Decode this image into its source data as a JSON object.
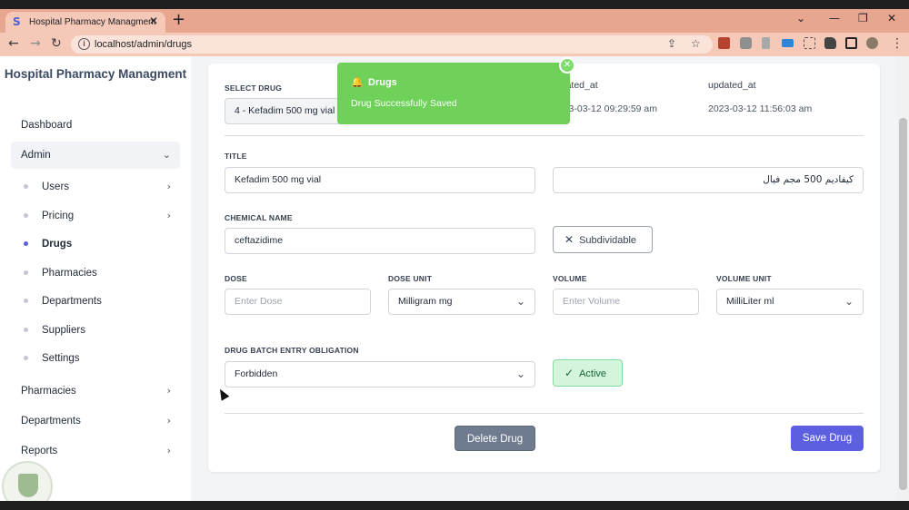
{
  "browser": {
    "tab_title": "Hospital Pharmacy Managment",
    "url": "localhost/admin/drugs",
    "favicon": "S",
    "close_icon": "close-icon",
    "new_tab": "+"
  },
  "sidebar": {
    "brand": "Hospital Pharmacy Managment",
    "items": [
      {
        "label": "Dashboard"
      },
      {
        "label": "Admin",
        "expanded": true
      },
      {
        "label": "Pharmacies"
      },
      {
        "label": "Departments"
      },
      {
        "label": "Reports"
      }
    ],
    "admin_children": [
      {
        "label": "Users",
        "has_children": true
      },
      {
        "label": "Pricing",
        "has_children": true
      },
      {
        "label": "Drugs",
        "active": true
      },
      {
        "label": "Pharmacies"
      },
      {
        "label": "Departments"
      },
      {
        "label": "Suppliers"
      },
      {
        "label": "Settings"
      }
    ]
  },
  "form": {
    "select_drug_label": "SELECT DRUG",
    "select_drug_value": "4  -  Kefadim 500 mg vial",
    "created_at_label": "created_at",
    "created_at_value": "2023-03-12 09:29:59 am",
    "updated_at_label": "updated_at",
    "updated_at_value": "2023-03-12 11:56:03 am",
    "title_label": "TITLE",
    "title_value": "Kefadim 500 mg vial",
    "title_ar_value": "كيفاديم 500 مجم فيال",
    "chemical_label": "CHEMICAL NAME",
    "chemical_value": "ceftazidime",
    "subdividable_label": "Subdividable",
    "subdividable_on": false,
    "dose_label": "DOSE",
    "dose_placeholder": "Enter Dose",
    "dose_unit_label": "DOSE UNIT",
    "dose_unit_value": "Milligram mg",
    "volume_label": "VOLUME",
    "volume_placeholder": "Enter Volume",
    "volume_unit_label": "VOLUME UNIT",
    "volume_unit_value": "MilliLiter ml",
    "batch_label": "DRUG BATCH ENTRY OBLIGATION",
    "batch_value": "Forbidden",
    "active_label": "Active",
    "active_on": true,
    "delete_button": "Delete Drug",
    "save_button": "Save Drug"
  },
  "toast": {
    "title": "Drugs",
    "message": "Drug Successfully Saved",
    "color": "#6fd05a"
  },
  "colors": {
    "accent": "#5b5fe0",
    "success": "#6fd05a",
    "tabbar": "#e8a58f"
  }
}
